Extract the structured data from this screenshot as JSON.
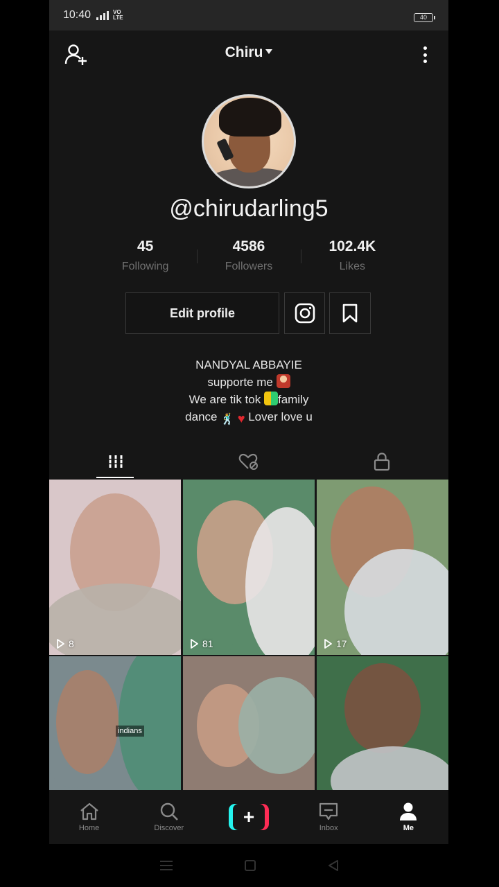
{
  "status_bar": {
    "time": "10:40",
    "network_type": "4G",
    "volte": "VO\nLTE",
    "battery": "40"
  },
  "header": {
    "profile_name": "Chiru",
    "add_friend_icon": "person-plus-icon",
    "more_icon": "vertical-dots-icon"
  },
  "profile": {
    "username": "@chirudarling5",
    "stats": [
      {
        "value": "45",
        "label": "Following"
      },
      {
        "value": "4586",
        "label": "Followers"
      },
      {
        "value": "102.4K",
        "label": "Likes"
      }
    ],
    "edit_profile_label": "Edit profile",
    "instagram_icon": "instagram-icon",
    "favorites_icon": "bookmark-icon",
    "bio": {
      "line1": "NANDYAL ABBAYIE",
      "line2": "supporte me",
      "line3a": "We are tik tok",
      "line3b": "family",
      "line4a": "dance",
      "line4b": "Lover love u"
    }
  },
  "tabs": [
    {
      "icon": "grid-icon",
      "active": true
    },
    {
      "icon": "liked-hidden-icon",
      "active": false
    },
    {
      "icon": "lock-icon",
      "active": false
    }
  ],
  "videos": [
    {
      "play_count": "8",
      "colors": [
        "#d9c7c9",
        "#c9a08f",
        "#b8b1a8"
      ]
    },
    {
      "play_count": "81",
      "colors": [
        "#5a8b6a",
        "#c8a08a",
        "#e9e6e8"
      ]
    },
    {
      "play_count": "17",
      "colors": [
        "#7e9b72",
        "#b07d63",
        "#d7dbe0"
      ]
    },
    {
      "play_count": "",
      "caption": "indians",
      "colors": [
        "#7b8a8e",
        "#a87f6a",
        "#4f8d76"
      ]
    },
    {
      "play_count": "",
      "colors": [
        "#8f7c72",
        "#c59b84",
        "#9ab0a6"
      ]
    },
    {
      "play_count": "",
      "colors": [
        "#3f6f4a",
        "#7a5240",
        "#c2c4c8"
      ]
    }
  ],
  "bottom_nav": [
    {
      "label": "Home",
      "icon": "home-icon",
      "active": false
    },
    {
      "label": "Discover",
      "icon": "search-icon",
      "active": false
    },
    {
      "label": "",
      "icon": "plus-icon",
      "active": false
    },
    {
      "label": "Inbox",
      "icon": "inbox-icon",
      "active": false
    },
    {
      "label": "Me",
      "icon": "person-icon",
      "active": true
    }
  ],
  "colors": {
    "background": "#161616",
    "accent_cyan": "#25f4ee",
    "accent_red": "#fe2c55"
  }
}
